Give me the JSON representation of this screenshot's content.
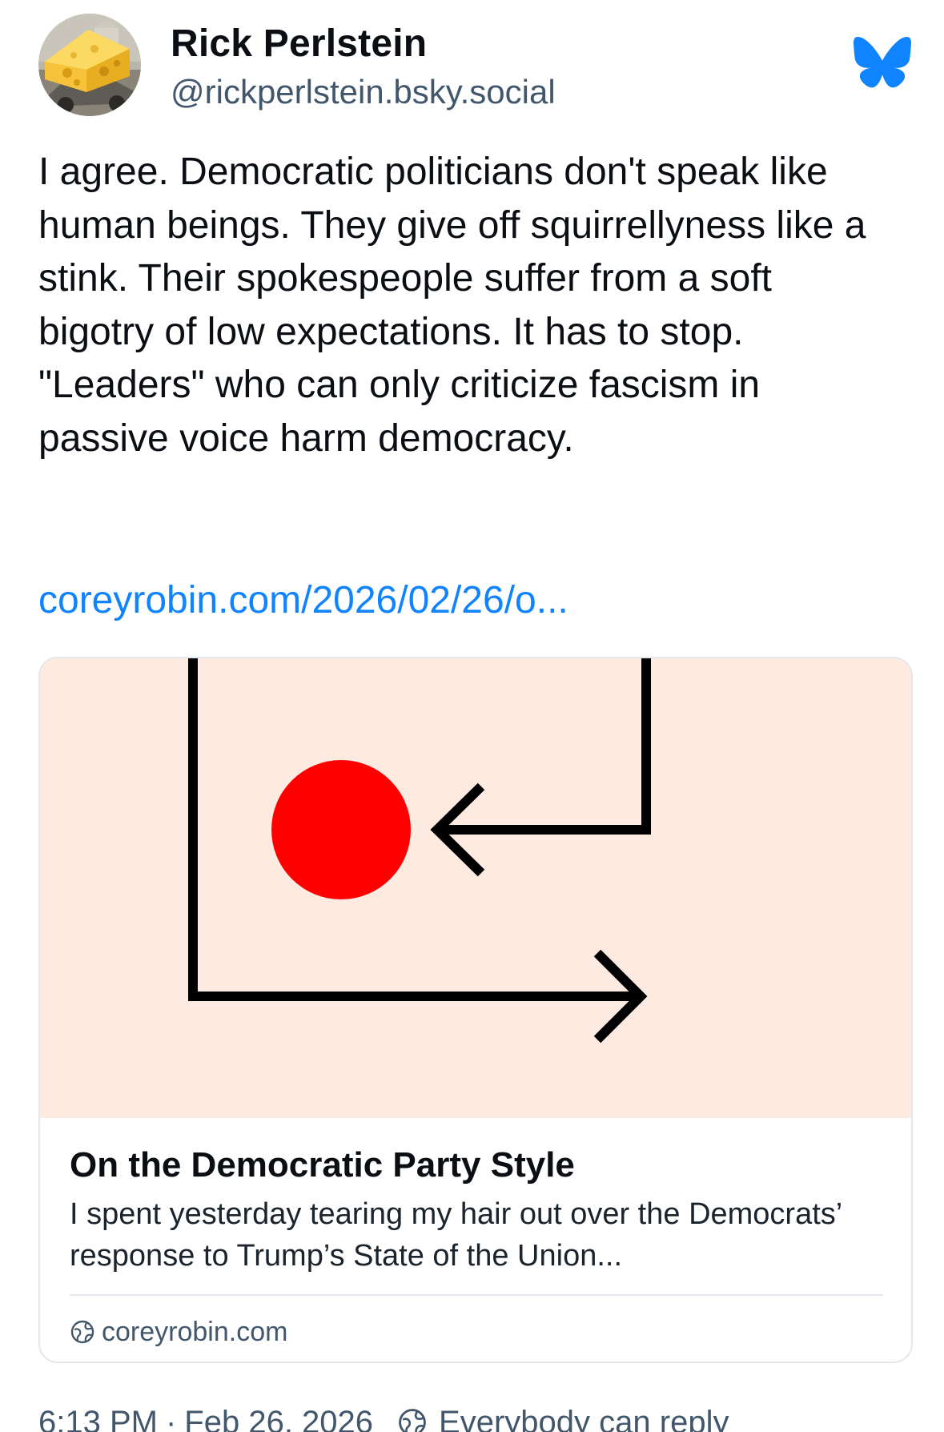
{
  "author": {
    "display_name": "Rick Perlstein",
    "handle": "@rickperlstein.bsky.social",
    "avatar_icon": "avatar-cheese-car-icon"
  },
  "app": {
    "logo_icon": "bluesky-butterfly-icon",
    "brand_color": "#1083fe"
  },
  "post": {
    "text": "I agree. Democratic politicians don't speak like human beings. They give off squirrellyness like a stink. Their spokespeople suffer from a soft bigotry of low expectations. It has to stop. \"Leaders\" who can only criticize fascism in passive voice harm democracy.",
    "link_text": "coreyrobin.com/2026/02/26/o..."
  },
  "link_card": {
    "title": "On the Democratic Party Style",
    "description": "I spent yesterday tearing my hair out over the Democrats’ response to Trump’s State of the Union...",
    "domain": "coreyrobin.com",
    "domain_icon": "globe-icon",
    "image_background": "#fdebe1",
    "image_dot_color": "#ff0000"
  },
  "meta": {
    "time": "6:13 PM",
    "separator": "·",
    "date": "Feb 26, 2026",
    "reply_setting": "Everybody can reply",
    "reply_icon": "globe-icon"
  }
}
